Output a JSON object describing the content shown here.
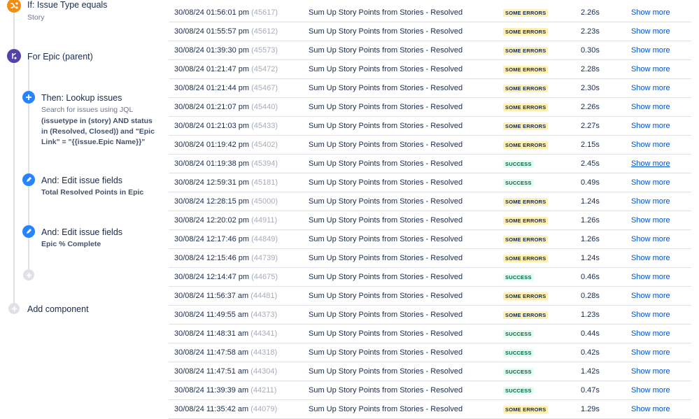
{
  "rule": {
    "condition": {
      "title": "If: Issue Type equals",
      "sub": "Story"
    },
    "branch": {
      "title": "For Epic (parent)"
    },
    "lookup": {
      "title": "Then: Lookup issues",
      "sub": "Search for issues using JQL",
      "jql_line1": "(issuetype in (story) AND status",
      "jql_line2": "in (Resolved, Closed)) and \"Epic",
      "jql_line3": "Link\" = \"{{issue.Epic Name}}\""
    },
    "edit1": {
      "title": "And: Edit issue fields",
      "field": "Total Resolved Points in Epic"
    },
    "edit2": {
      "title": "And: Edit issue fields",
      "field": "Epic % Complete"
    },
    "add_component": "Add component"
  },
  "audit_log": {
    "show_more_label": "Show more",
    "status_colors": {
      "SOME ERRORS": "#fff0b3",
      "SUCCESS": "#e3fcef"
    },
    "rows": [
      {
        "date": "30/08/24 01:56:01 pm",
        "id": "(45617)",
        "rule": "Sum Up Story Points from Stories - Resolved",
        "status": "SOME ERRORS",
        "duration": "2.26s"
      },
      {
        "date": "30/08/24 01:55:57 pm",
        "id": "(45612)",
        "rule": "Sum Up Story Points from Stories - Resolved",
        "status": "SOME ERRORS",
        "duration": "2.23s"
      },
      {
        "date": "30/08/24 01:39:30 pm",
        "id": "(45573)",
        "rule": "Sum Up Story Points from Stories - Resolved",
        "status": "SOME ERRORS",
        "duration": "0.30s"
      },
      {
        "date": "30/08/24 01:21:47 pm",
        "id": "(45472)",
        "rule": "Sum Up Story Points from Stories - Resolved",
        "status": "SOME ERRORS",
        "duration": "2.28s"
      },
      {
        "date": "30/08/24 01:21:44 pm",
        "id": "(45467)",
        "rule": "Sum Up Story Points from Stories - Resolved",
        "status": "SOME ERRORS",
        "duration": "2.30s"
      },
      {
        "date": "30/08/24 01:21:07 pm",
        "id": "(45440)",
        "rule": "Sum Up Story Points from Stories - Resolved",
        "status": "SOME ERRORS",
        "duration": "2.26s"
      },
      {
        "date": "30/08/24 01:21:03 pm",
        "id": "(45433)",
        "rule": "Sum Up Story Points from Stories - Resolved",
        "status": "SOME ERRORS",
        "duration": "2.27s"
      },
      {
        "date": "30/08/24 01:19:42 pm",
        "id": "(45402)",
        "rule": "Sum Up Story Points from Stories - Resolved",
        "status": "SOME ERRORS",
        "duration": "2.15s"
      },
      {
        "date": "30/08/24 01:19:38 pm",
        "id": "(45394)",
        "rule": "Sum Up Story Points from Stories - Resolved",
        "status": "SUCCESS",
        "duration": "2.45s"
      },
      {
        "date": "30/08/24 12:59:31 pm",
        "id": "(45181)",
        "rule": "Sum Up Story Points from Stories - Resolved",
        "status": "SUCCESS",
        "duration": "0.49s"
      },
      {
        "date": "30/08/24 12:28:15 pm",
        "id": "(45000)",
        "rule": "Sum Up Story Points from Stories - Resolved",
        "status": "SOME ERRORS",
        "duration": "1.24s"
      },
      {
        "date": "30/08/24 12:20:02 pm",
        "id": "(44911)",
        "rule": "Sum Up Story Points from Stories - Resolved",
        "status": "SOME ERRORS",
        "duration": "1.26s"
      },
      {
        "date": "30/08/24 12:17:46 pm",
        "id": "(44849)",
        "rule": "Sum Up Story Points from Stories - Resolved",
        "status": "SOME ERRORS",
        "duration": "1.26s"
      },
      {
        "date": "30/08/24 12:15:46 pm",
        "id": "(44739)",
        "rule": "Sum Up Story Points from Stories - Resolved",
        "status": "SOME ERRORS",
        "duration": "1.24s"
      },
      {
        "date": "30/08/24 12:14:47 pm",
        "id": "(44675)",
        "rule": "Sum Up Story Points from Stories - Resolved",
        "status": "SUCCESS",
        "duration": "0.46s"
      },
      {
        "date": "30/08/24 11:56:37 am",
        "id": "(44481)",
        "rule": "Sum Up Story Points from Stories - Resolved",
        "status": "SOME ERRORS",
        "duration": "0.28s"
      },
      {
        "date": "30/08/24 11:49:55 am",
        "id": "(44373)",
        "rule": "Sum Up Story Points from Stories - Resolved",
        "status": "SOME ERRORS",
        "duration": "1.23s"
      },
      {
        "date": "30/08/24 11:48:31 am",
        "id": "(44341)",
        "rule": "Sum Up Story Points from Stories - Resolved",
        "status": "SUCCESS",
        "duration": "0.44s"
      },
      {
        "date": "30/08/24 11:47:58 am",
        "id": "(44318)",
        "rule": "Sum Up Story Points from Stories - Resolved",
        "status": "SUCCESS",
        "duration": "0.42s"
      },
      {
        "date": "30/08/24 11:47:51 am",
        "id": "(44304)",
        "rule": "Sum Up Story Points from Stories - Resolved",
        "status": "SUCCESS",
        "duration": "1.42s"
      },
      {
        "date": "30/08/24 11:39:39 am",
        "id": "(44211)",
        "rule": "Sum Up Story Points from Stories - Resolved",
        "status": "SUCCESS",
        "duration": "0.47s"
      },
      {
        "date": "30/08/24 11:35:42 am",
        "id": "(44079)",
        "rule": "Sum Up Story Points from Stories - Resolved",
        "status": "SOME ERRORS",
        "duration": "1.29s"
      }
    ]
  }
}
